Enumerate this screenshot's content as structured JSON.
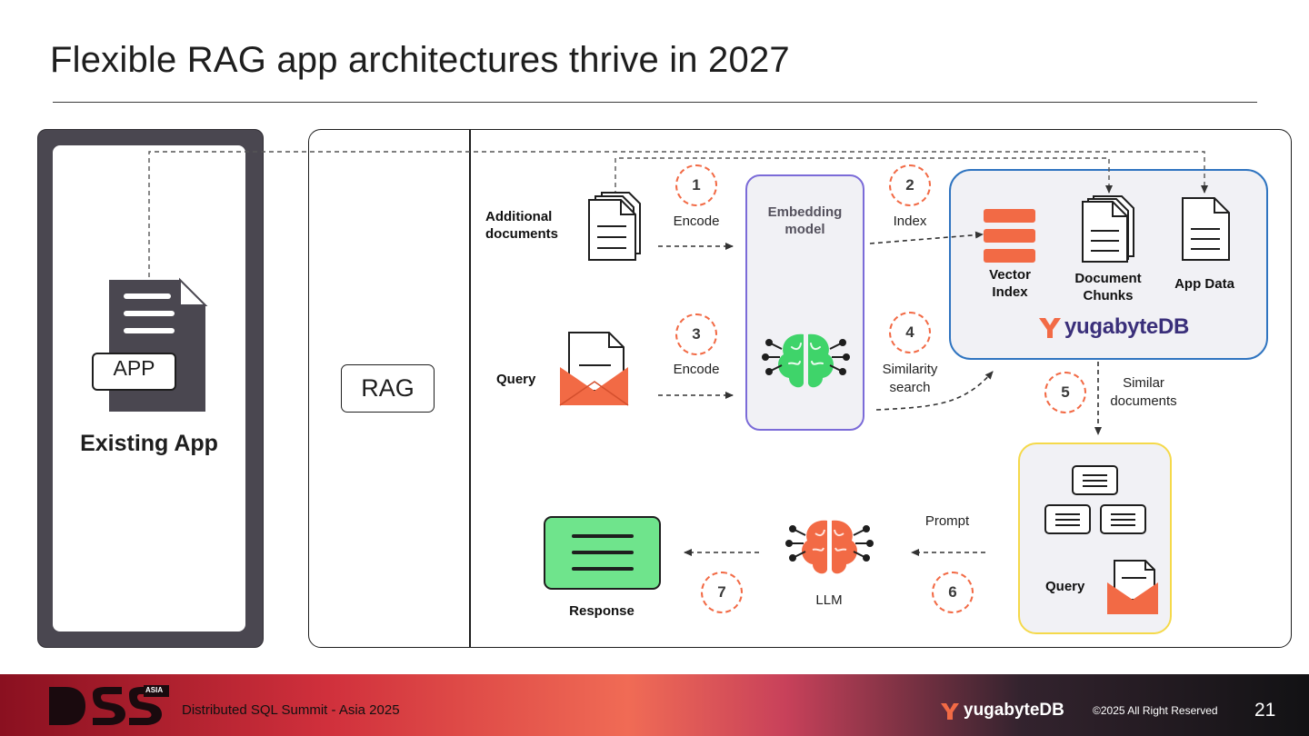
{
  "slide": {
    "title": "Flexible RAG app architectures thrive in 2027",
    "page_number": "21"
  },
  "existing_app": {
    "badge": "APP",
    "label": "Existing App"
  },
  "rag": {
    "label": "RAG"
  },
  "flow": {
    "additional_documents": [
      "Additional",
      "documents"
    ],
    "query_label": "Query",
    "steps": [
      {
        "number": "1",
        "label": [
          "Encode"
        ]
      },
      {
        "number": "2",
        "label": [
          "Index"
        ]
      },
      {
        "number": "3",
        "label": [
          "Encode"
        ]
      },
      {
        "number": "4",
        "label": [
          "Similarity",
          "search"
        ]
      },
      {
        "number": "5",
        "label": [
          "Similar",
          "documents"
        ]
      },
      {
        "number": "6",
        "label": [
          "Prompt"
        ]
      },
      {
        "number": "7",
        "label": []
      }
    ],
    "embedding_model": [
      "Embedding",
      "model"
    ],
    "llm_label": "LLM",
    "response_label": "Response",
    "context_query_label": "Query"
  },
  "database": {
    "vector_index": [
      "Vector",
      "Index"
    ],
    "document_chunks": [
      "Document",
      "Chunks"
    ],
    "app_data": "App Data",
    "brand": "yugabyteDB"
  },
  "footer": {
    "event": "Distributed SQL Summit - Asia 2025",
    "brand": "yugabyteDB",
    "copyright": "©2025 All Right Reserved",
    "event_badge": "ASIA"
  },
  "colors": {
    "accent_orange": "#f26a45",
    "embedding_border": "#7b6bd8",
    "db_border": "#2f74c0",
    "query_border": "#f5d94a",
    "response_fill": "#6fe48c",
    "brain_green": "#3fd46a",
    "app_panel": "#4a4750"
  }
}
